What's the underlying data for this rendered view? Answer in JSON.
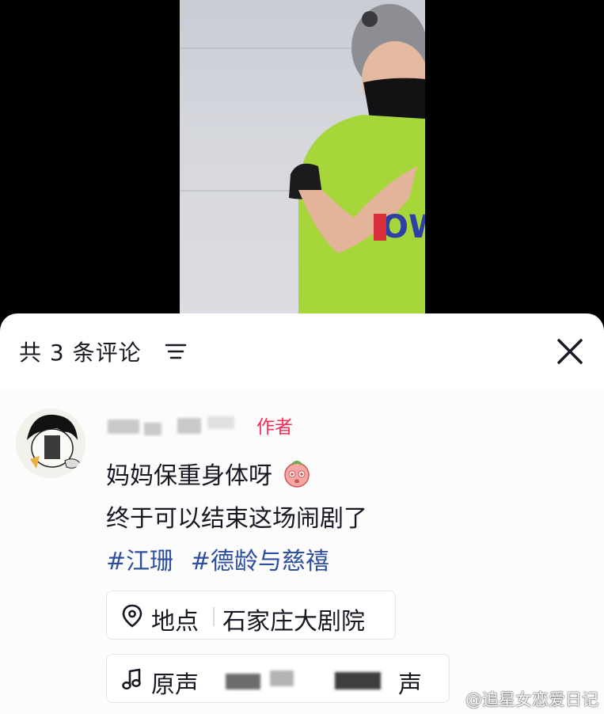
{
  "comments_header": {
    "title": "共 3 条评论"
  },
  "comment": {
    "author_tag": "作者",
    "line1": "妈妈保重身体呀",
    "line2": "终于可以结束这场闹剧了",
    "hashtags": [
      "#江珊",
      "#德龄与慈禧"
    ]
  },
  "location_chip": {
    "label": "地点",
    "value": "石家庄大剧院"
  },
  "music_chip": {
    "label": "原声",
    "value_tail": "声"
  },
  "watermark": "@追星女恋爱日记",
  "colors": {
    "accent_red": "#fe2c55",
    "hashtag_blue": "#2d4f9e",
    "shirt_green": "#a7d63a"
  },
  "icons": [
    "sort-icon",
    "close-icon",
    "location-pin-icon",
    "music-note-icon",
    "emoji-icon"
  ]
}
